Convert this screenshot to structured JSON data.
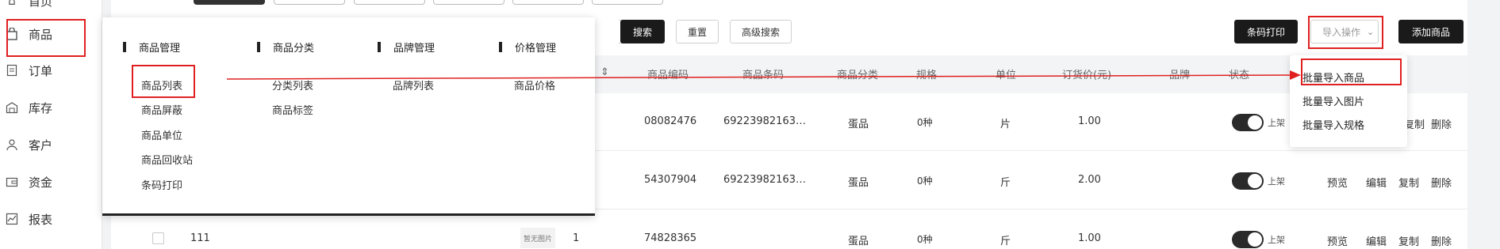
{
  "sidebar": {
    "items": [
      {
        "label": "首页",
        "icon": "home-icon"
      },
      {
        "label": "商品",
        "icon": "bag-icon"
      },
      {
        "label": "订单",
        "icon": "order-icon"
      },
      {
        "label": "库存",
        "icon": "warehouse-icon"
      },
      {
        "label": "客户",
        "icon": "user-icon"
      },
      {
        "label": "资金",
        "icon": "wallet-icon"
      },
      {
        "label": "报表",
        "icon": "chart-icon"
      }
    ]
  },
  "toolbar": {
    "search_label": "搜索",
    "reset_label": "重置",
    "advanced_label": "高级搜索",
    "barcode_print_label": "条码打印",
    "import_label": "导入操作",
    "add_label": "添加商品"
  },
  "import_menu": {
    "options": [
      "批量导入商品",
      "批量导入图片",
      "批量导入规格"
    ]
  },
  "mega_menu": {
    "columns": [
      {
        "title": "商品管理",
        "items": [
          "商品列表",
          "商品屏蔽",
          "商品单位",
          "商品回收站",
          "条码打印"
        ]
      },
      {
        "title": "商品分类",
        "items": [
          "分类列表",
          "商品标签"
        ]
      },
      {
        "title": "品牌管理",
        "items": [
          "品牌列表"
        ]
      },
      {
        "title": "价格管理",
        "items": [
          "商品价格"
        ]
      }
    ]
  },
  "table": {
    "headers": [
      "商品编码",
      "商品条码",
      "商品分类",
      "规格",
      "单位",
      "订货价(元)",
      "品牌",
      "状态"
    ],
    "rows": [
      {
        "code": "08082476",
        "barcode": "69223982163…",
        "category": "蛋品",
        "spec": "0种",
        "unit": "片",
        "price": "1.00",
        "status": "上架",
        "actions": [
          "复制",
          "删除"
        ]
      },
      {
        "code": "54307904",
        "barcode": "69223982163…",
        "category": "蛋品",
        "spec": "0种",
        "unit": "斤",
        "price": "2.00",
        "status": "上架",
        "actions": [
          "预览",
          "编辑",
          "复制",
          "删除"
        ]
      },
      {
        "name": "111",
        "img": "暂无图片",
        "seq": "1",
        "code": "74828365",
        "barcode": "",
        "category": "蛋品",
        "spec": "0种",
        "unit": "斤",
        "price": "1.00",
        "status": "上架",
        "actions": [
          "预览",
          "编辑",
          "复制",
          "删除"
        ]
      }
    ]
  },
  "colors": {
    "highlight": "#e02020",
    "dark": "#1a1a1a"
  }
}
